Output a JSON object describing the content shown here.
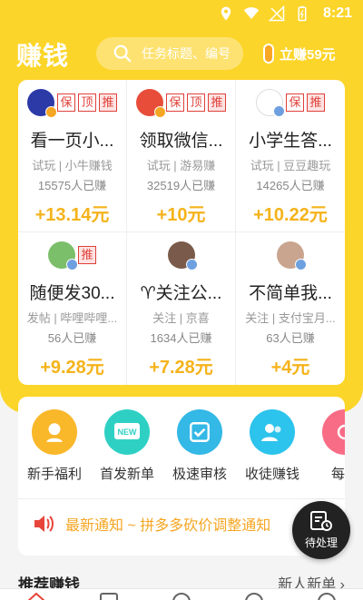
{
  "status": {
    "time": "8:21"
  },
  "header": {
    "logo": "赚钱",
    "search_placeholder": "任务标题、编号",
    "earn_label": "立赚59元"
  },
  "tasks": [
    {
      "title": "看一页小...",
      "meta": "试玩 | 小牛赚钱",
      "count": "15575人已赚",
      "reward": "+13.14元",
      "tags": [
        "保",
        "顶",
        "推"
      ],
      "avatar_color": "#2c3aa8",
      "vip": "orange"
    },
    {
      "title": "领取微信...",
      "meta": "试玩 | 游易赚",
      "count": "32519人已赚",
      "reward": "+10元",
      "tags": [
        "保",
        "顶",
        "推"
      ],
      "avatar_color": "#e84d3a",
      "vip": "orange"
    },
    {
      "title": "小学生答...",
      "meta": "试玩 | 豆豆趣玩",
      "count": "14265人已赚",
      "reward": "+10.22元",
      "tags": [
        "保",
        "推"
      ],
      "avatar_color": "#ffffff",
      "vip": "blue"
    },
    {
      "title": "随便发30...",
      "meta": "发帖 | 哔哩哔哩...",
      "count": "56人已赚",
      "reward": "+9.28元",
      "tags": [
        "推"
      ],
      "avatar_color": "#7bbf6a",
      "vip": "blue"
    },
    {
      "title": "♈关注公...",
      "meta": "关注 | 京喜",
      "count": "1634人已赚",
      "reward": "+7.28元",
      "tags": [],
      "avatar_color": "#7a5a4a",
      "vip": "blue"
    },
    {
      "title": "不简单我...",
      "meta": "关注 | 支付宝月...",
      "count": "63人已赚",
      "reward": "+4元",
      "tags": [],
      "avatar_color": "#c9a58f",
      "vip": "blue"
    }
  ],
  "quick_actions": [
    {
      "label": "新手福利",
      "color": "#f9b72a",
      "icon": "gift-face-icon"
    },
    {
      "label": "首发新单",
      "color": "#2fd0c4",
      "icon": "new-badge-icon"
    },
    {
      "label": "极速审核",
      "color": "#34b8e6",
      "icon": "check-icon"
    },
    {
      "label": "收徒赚钱",
      "color": "#2cc3ec",
      "icon": "people-icon"
    },
    {
      "label": "每日",
      "color": "#f86c86",
      "icon": "daily-icon"
    }
  ],
  "notice": "最新通知 ~ 拼多多砍价调整通知",
  "fab_label": "待处理",
  "recommend": {
    "left": "推荐赚钱",
    "right": "新人新单 ›"
  }
}
